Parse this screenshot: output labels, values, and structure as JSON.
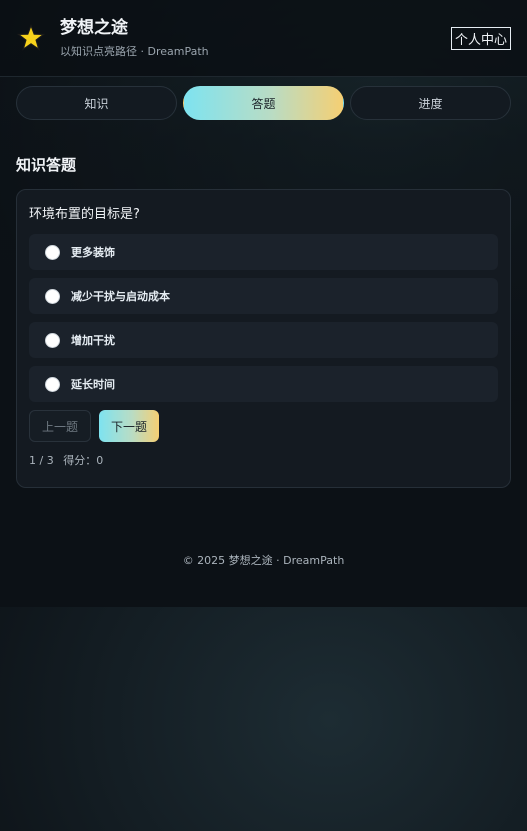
{
  "header": {
    "title": "梦想之途",
    "subtitle": "以知识点亮路径 · DreamPath",
    "profile_label": "个人中心",
    "logo_icon": "star-icon"
  },
  "tabs": [
    {
      "label": "知识",
      "active": false
    },
    {
      "label": "答题",
      "active": true
    },
    {
      "label": "进度",
      "active": false
    }
  ],
  "section": {
    "title": "知识答题"
  },
  "quiz": {
    "question": "环境布置的目标是?",
    "options": [
      {
        "label": "更多装饰",
        "selected": false
      },
      {
        "label": "减少干扰与启动成本",
        "selected": false
      },
      {
        "label": "增加干扰",
        "selected": false
      },
      {
        "label": "延长时间",
        "selected": false
      }
    ],
    "prev_label": "上一题",
    "next_label": "下一题",
    "progress_text": "1 / 3",
    "score_text": "得分：0"
  },
  "footer": {
    "text": "© 2025 梦想之途 · DreamPath"
  },
  "colors": {
    "accent_start": "#7ee3f0",
    "accent_end": "#f5cf73",
    "background": "#0c1116",
    "card": "#141a21"
  }
}
